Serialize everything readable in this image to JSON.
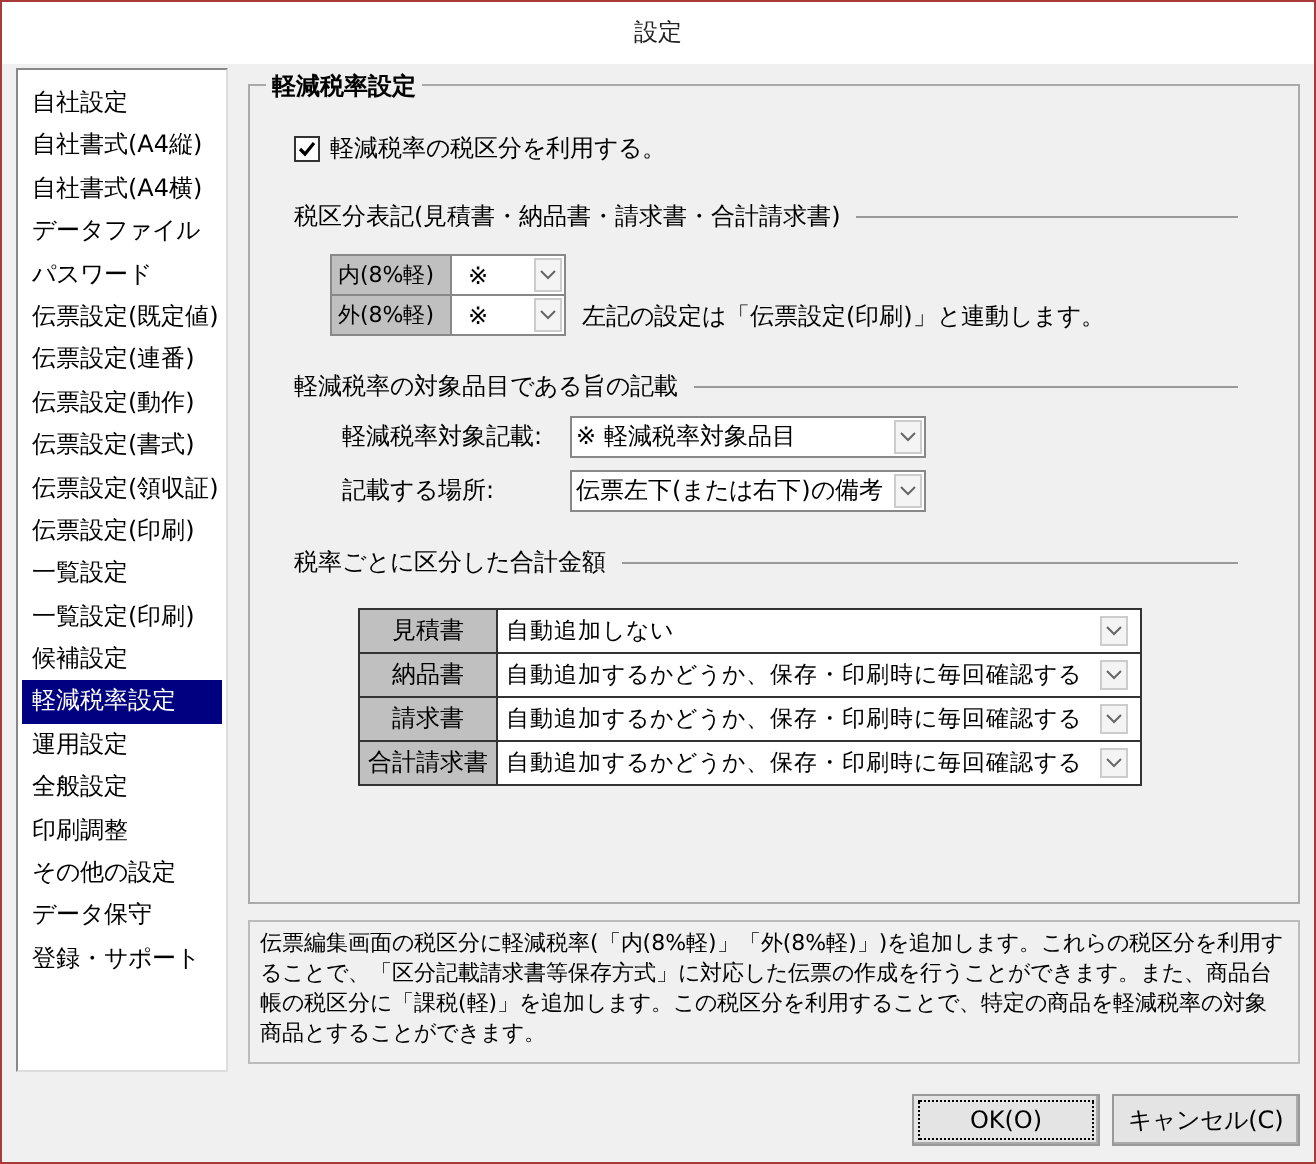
{
  "window": {
    "title": "設定"
  },
  "sidebar": {
    "items": [
      {
        "label": "自社設定",
        "selected": false
      },
      {
        "label": "自社書式(A4縦)",
        "selected": false
      },
      {
        "label": "自社書式(A4横)",
        "selected": false
      },
      {
        "label": "データファイル",
        "selected": false
      },
      {
        "label": "パスワード",
        "selected": false
      },
      {
        "label": "伝票設定(既定値)",
        "selected": false
      },
      {
        "label": "伝票設定(連番)",
        "selected": false
      },
      {
        "label": "伝票設定(動作)",
        "selected": false
      },
      {
        "label": "伝票設定(書式)",
        "selected": false
      },
      {
        "label": "伝票設定(領収証)",
        "selected": false
      },
      {
        "label": "伝票設定(印刷)",
        "selected": false
      },
      {
        "label": "一覧設定",
        "selected": false
      },
      {
        "label": "一覧設定(印刷)",
        "selected": false
      },
      {
        "label": "候補設定",
        "selected": false
      },
      {
        "label": "軽減税率設定",
        "selected": true
      },
      {
        "label": "運用設定",
        "selected": false
      },
      {
        "label": "全般設定",
        "selected": false
      },
      {
        "label": "印刷調整",
        "selected": false
      },
      {
        "label": "その他の設定",
        "selected": false
      },
      {
        "label": "データ保守",
        "selected": false
      },
      {
        "label": "登録・サポート",
        "selected": false
      }
    ]
  },
  "panel": {
    "title": "軽減税率設定",
    "use_reduced_rate": {
      "label": "軽減税率の税区分を利用する。",
      "checked": true
    },
    "tax_notation": {
      "heading": "税区分表記(見積書・納品書・請求書・合計請求書)",
      "rows": [
        {
          "label": "内(8%軽)",
          "value": "※"
        },
        {
          "label": "外(8%軽)",
          "value": "※"
        }
      ],
      "note": "左記の設定は「伝票設定(印刷)」と連動します。"
    },
    "target_notation": {
      "heading": "軽減税率の対象品目である旨の記載",
      "fields": [
        {
          "label": "軽減税率対象記載:",
          "value": "※ 軽減税率対象品目"
        },
        {
          "label": "記載する場所:",
          "value": "伝票左下(または右下)の備考"
        }
      ]
    },
    "totals": {
      "heading": "税率ごとに区分した合計金額",
      "rows": [
        {
          "label": "見積書",
          "value": "自動追加しない"
        },
        {
          "label": "納品書",
          "value": "自動追加するかどうか、保存・印刷時に毎回確認する"
        },
        {
          "label": "請求書",
          "value": "自動追加するかどうか、保存・印刷時に毎回確認する"
        },
        {
          "label": "合計請求書",
          "value": "自動追加するかどうか、保存・印刷時に毎回確認する"
        }
      ]
    }
  },
  "description": "伝票編集画面の税区分に軽減税率(「内(8%軽)」「外(8%軽)」)を追加します。これらの税区分を利用することで、「区分記載請求書等保存方式」に対応した伝票の作成を行うことができます。また、商品台帳の税区分に「課税(軽)」を追加します。この税区分を利用することで、特定の商品を軽減税率の対象商品とすることができます。",
  "buttons": [
    {
      "label": "OK(O)",
      "focused": true
    },
    {
      "label": "キャンセル(C)",
      "focused": false
    }
  ]
}
